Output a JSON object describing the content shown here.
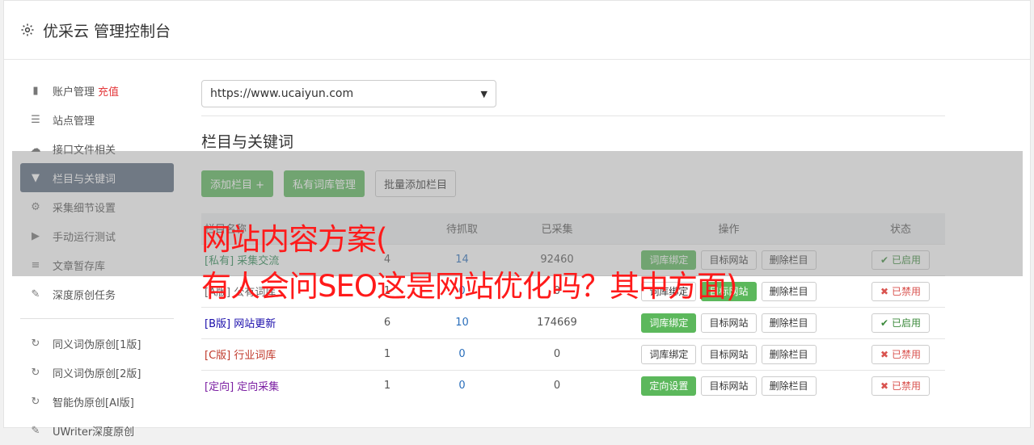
{
  "header": {
    "title": "优采云 管理控制台"
  },
  "sidebar": {
    "items": [
      {
        "label": "账户管理",
        "extra": "充值",
        "icon": "bar-chart-icon"
      },
      {
        "label": "站点管理",
        "icon": "server-icon"
      },
      {
        "label": "接口文件相关",
        "icon": "cloud-upload-icon"
      },
      {
        "label": "栏目与关键词",
        "icon": "filter-icon",
        "active": true
      },
      {
        "label": "采集细节设置",
        "icon": "gears-icon"
      },
      {
        "label": "手动运行测试",
        "icon": "play-circle-icon"
      },
      {
        "label": "文章暂存库",
        "icon": "database-icon"
      },
      {
        "label": "深度原创任务",
        "icon": "edit-icon"
      }
    ],
    "items2": [
      {
        "label": "同义词伪原创[1版]",
        "icon": "refresh-icon"
      },
      {
        "label": "同义词伪原创[2版]",
        "icon": "refresh-icon"
      },
      {
        "label": "智能伪原创[AI版]",
        "icon": "refresh-icon"
      },
      {
        "label": "UWriter深度原创",
        "icon": "edit-icon"
      }
    ]
  },
  "main": {
    "site_select": {
      "value": "https://www.ucaiyun.com"
    },
    "section_title": "栏目与关键词",
    "buttons": {
      "add_column": "添加栏目 +",
      "private_lib": "私有词库管理",
      "batch_add": "批量添加栏目"
    },
    "table": {
      "headers": [
        "栏目名称",
        "待抓取",
        "已采集",
        "操作",
        "状态"
      ],
      "header_hidden": "栏目名称",
      "rows": [
        {
          "tag": "[私有]",
          "name": "采集交流",
          "kw": "4",
          "pending": "14",
          "collected": "92460",
          "op1": "词库绑定",
          "op1_green": true,
          "op2": "目标网站",
          "op3": "删除栏目",
          "status": "已启用",
          "on": true
        },
        {
          "tag": "[A版]",
          "name": "公有词库",
          "kw": "1",
          "pending": "0",
          "collected": "0",
          "op1": "词库绑定",
          "op1_green": false,
          "op2": "目标网站",
          "op3": "删除栏目",
          "status": "已禁用",
          "on": false
        },
        {
          "tag": "[B版]",
          "name": "网站更新",
          "kw": "6",
          "pending": "10",
          "collected": "174669",
          "op1": "词库绑定",
          "op1_green": true,
          "op2": "目标网站",
          "op3": "删除栏目",
          "status": "已启用",
          "on": true
        },
        {
          "tag": "[C版]",
          "name": "行业词库",
          "kw": "1",
          "pending": "0",
          "collected": "0",
          "op1": "词库绑定",
          "op1_green": false,
          "op2": "目标网站",
          "op3": "删除栏目",
          "status": "已禁用",
          "on": false
        },
        {
          "tag": "[定向]",
          "name": "定向采集",
          "kw": "1",
          "pending": "0",
          "collected": "0",
          "op1": "定向设置",
          "op1_green": true,
          "op2": "目标网站",
          "op3": "删除栏目",
          "status": "已禁用",
          "on": false
        }
      ]
    }
  },
  "overlay": {
    "line1": "网站内容方案(",
    "line2": "有人会问SEO这是网站优化吗？其中方面)"
  },
  "colors": {
    "accent_green": "#5cb85c",
    "sidebar_active": "#5a6a7e",
    "overlay_text": "#ff1a1a"
  }
}
